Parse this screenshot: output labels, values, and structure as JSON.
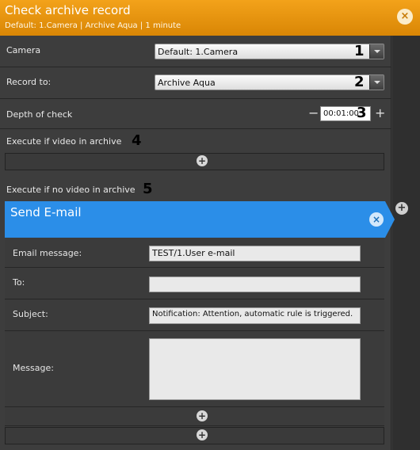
{
  "header": {
    "title": "Check archive record",
    "subtitle": "Default: 1.Camera | Archive Aqua | 1 minute",
    "close_icon": "×"
  },
  "camera": {
    "label": "Camera",
    "value": "Default: 1.Camera",
    "marker": "1"
  },
  "record_to": {
    "label": "Record to:",
    "value": "Archive Aqua",
    "marker": "2"
  },
  "depth": {
    "label": "Depth of check",
    "minus": "−",
    "value": "00:01:00",
    "plus": "+",
    "marker": "3"
  },
  "exec_video": {
    "label": "Execute if video in archive",
    "marker": "4",
    "add_icon": "+"
  },
  "exec_no_video": {
    "label": "Execute if no video in archive",
    "marker": "5",
    "side_add_icon": "+"
  },
  "send_email": {
    "title": "Send E-mail",
    "close_icon": "×",
    "email_message_label": "Email message:",
    "email_message_value": "TEST/1.User e-mail",
    "to_label": "To:",
    "to_value": "",
    "subject_label": "Subject:",
    "subject_value": "Notification: Attention, automatic rule is triggered.",
    "message_label": "Message:",
    "message_value": "",
    "add_icon": "+"
  },
  "bottom_add_icon": "+",
  "colors": {
    "header": "#e9960e",
    "action_header": "#2b8ee8",
    "panel": "#3d3d3d"
  }
}
